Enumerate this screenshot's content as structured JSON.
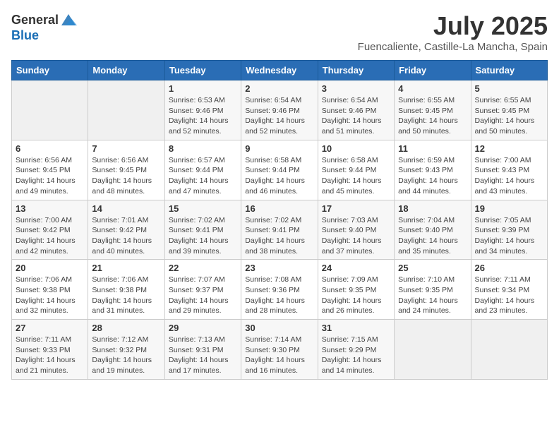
{
  "header": {
    "logo_general": "General",
    "logo_blue": "Blue",
    "month": "July 2025",
    "location": "Fuencaliente, Castille-La Mancha, Spain"
  },
  "weekdays": [
    "Sunday",
    "Monday",
    "Tuesday",
    "Wednesday",
    "Thursday",
    "Friday",
    "Saturday"
  ],
  "weeks": [
    [
      {
        "day": "",
        "info": ""
      },
      {
        "day": "",
        "info": ""
      },
      {
        "day": "1",
        "info": "Sunrise: 6:53 AM\nSunset: 9:46 PM\nDaylight: 14 hours and 52 minutes."
      },
      {
        "day": "2",
        "info": "Sunrise: 6:54 AM\nSunset: 9:46 PM\nDaylight: 14 hours and 52 minutes."
      },
      {
        "day": "3",
        "info": "Sunrise: 6:54 AM\nSunset: 9:46 PM\nDaylight: 14 hours and 51 minutes."
      },
      {
        "day": "4",
        "info": "Sunrise: 6:55 AM\nSunset: 9:45 PM\nDaylight: 14 hours and 50 minutes."
      },
      {
        "day": "5",
        "info": "Sunrise: 6:55 AM\nSunset: 9:45 PM\nDaylight: 14 hours and 50 minutes."
      }
    ],
    [
      {
        "day": "6",
        "info": "Sunrise: 6:56 AM\nSunset: 9:45 PM\nDaylight: 14 hours and 49 minutes."
      },
      {
        "day": "7",
        "info": "Sunrise: 6:56 AM\nSunset: 9:45 PM\nDaylight: 14 hours and 48 minutes."
      },
      {
        "day": "8",
        "info": "Sunrise: 6:57 AM\nSunset: 9:44 PM\nDaylight: 14 hours and 47 minutes."
      },
      {
        "day": "9",
        "info": "Sunrise: 6:58 AM\nSunset: 9:44 PM\nDaylight: 14 hours and 46 minutes."
      },
      {
        "day": "10",
        "info": "Sunrise: 6:58 AM\nSunset: 9:44 PM\nDaylight: 14 hours and 45 minutes."
      },
      {
        "day": "11",
        "info": "Sunrise: 6:59 AM\nSunset: 9:43 PM\nDaylight: 14 hours and 44 minutes."
      },
      {
        "day": "12",
        "info": "Sunrise: 7:00 AM\nSunset: 9:43 PM\nDaylight: 14 hours and 43 minutes."
      }
    ],
    [
      {
        "day": "13",
        "info": "Sunrise: 7:00 AM\nSunset: 9:42 PM\nDaylight: 14 hours and 42 minutes."
      },
      {
        "day": "14",
        "info": "Sunrise: 7:01 AM\nSunset: 9:42 PM\nDaylight: 14 hours and 40 minutes."
      },
      {
        "day": "15",
        "info": "Sunrise: 7:02 AM\nSunset: 9:41 PM\nDaylight: 14 hours and 39 minutes."
      },
      {
        "day": "16",
        "info": "Sunrise: 7:02 AM\nSunset: 9:41 PM\nDaylight: 14 hours and 38 minutes."
      },
      {
        "day": "17",
        "info": "Sunrise: 7:03 AM\nSunset: 9:40 PM\nDaylight: 14 hours and 37 minutes."
      },
      {
        "day": "18",
        "info": "Sunrise: 7:04 AM\nSunset: 9:40 PM\nDaylight: 14 hours and 35 minutes."
      },
      {
        "day": "19",
        "info": "Sunrise: 7:05 AM\nSunset: 9:39 PM\nDaylight: 14 hours and 34 minutes."
      }
    ],
    [
      {
        "day": "20",
        "info": "Sunrise: 7:06 AM\nSunset: 9:38 PM\nDaylight: 14 hours and 32 minutes."
      },
      {
        "day": "21",
        "info": "Sunrise: 7:06 AM\nSunset: 9:38 PM\nDaylight: 14 hours and 31 minutes."
      },
      {
        "day": "22",
        "info": "Sunrise: 7:07 AM\nSunset: 9:37 PM\nDaylight: 14 hours and 29 minutes."
      },
      {
        "day": "23",
        "info": "Sunrise: 7:08 AM\nSunset: 9:36 PM\nDaylight: 14 hours and 28 minutes."
      },
      {
        "day": "24",
        "info": "Sunrise: 7:09 AM\nSunset: 9:35 PM\nDaylight: 14 hours and 26 minutes."
      },
      {
        "day": "25",
        "info": "Sunrise: 7:10 AM\nSunset: 9:35 PM\nDaylight: 14 hours and 24 minutes."
      },
      {
        "day": "26",
        "info": "Sunrise: 7:11 AM\nSunset: 9:34 PM\nDaylight: 14 hours and 23 minutes."
      }
    ],
    [
      {
        "day": "27",
        "info": "Sunrise: 7:11 AM\nSunset: 9:33 PM\nDaylight: 14 hours and 21 minutes."
      },
      {
        "day": "28",
        "info": "Sunrise: 7:12 AM\nSunset: 9:32 PM\nDaylight: 14 hours and 19 minutes."
      },
      {
        "day": "29",
        "info": "Sunrise: 7:13 AM\nSunset: 9:31 PM\nDaylight: 14 hours and 17 minutes."
      },
      {
        "day": "30",
        "info": "Sunrise: 7:14 AM\nSunset: 9:30 PM\nDaylight: 14 hours and 16 minutes."
      },
      {
        "day": "31",
        "info": "Sunrise: 7:15 AM\nSunset: 9:29 PM\nDaylight: 14 hours and 14 minutes."
      },
      {
        "day": "",
        "info": ""
      },
      {
        "day": "",
        "info": ""
      }
    ]
  ]
}
